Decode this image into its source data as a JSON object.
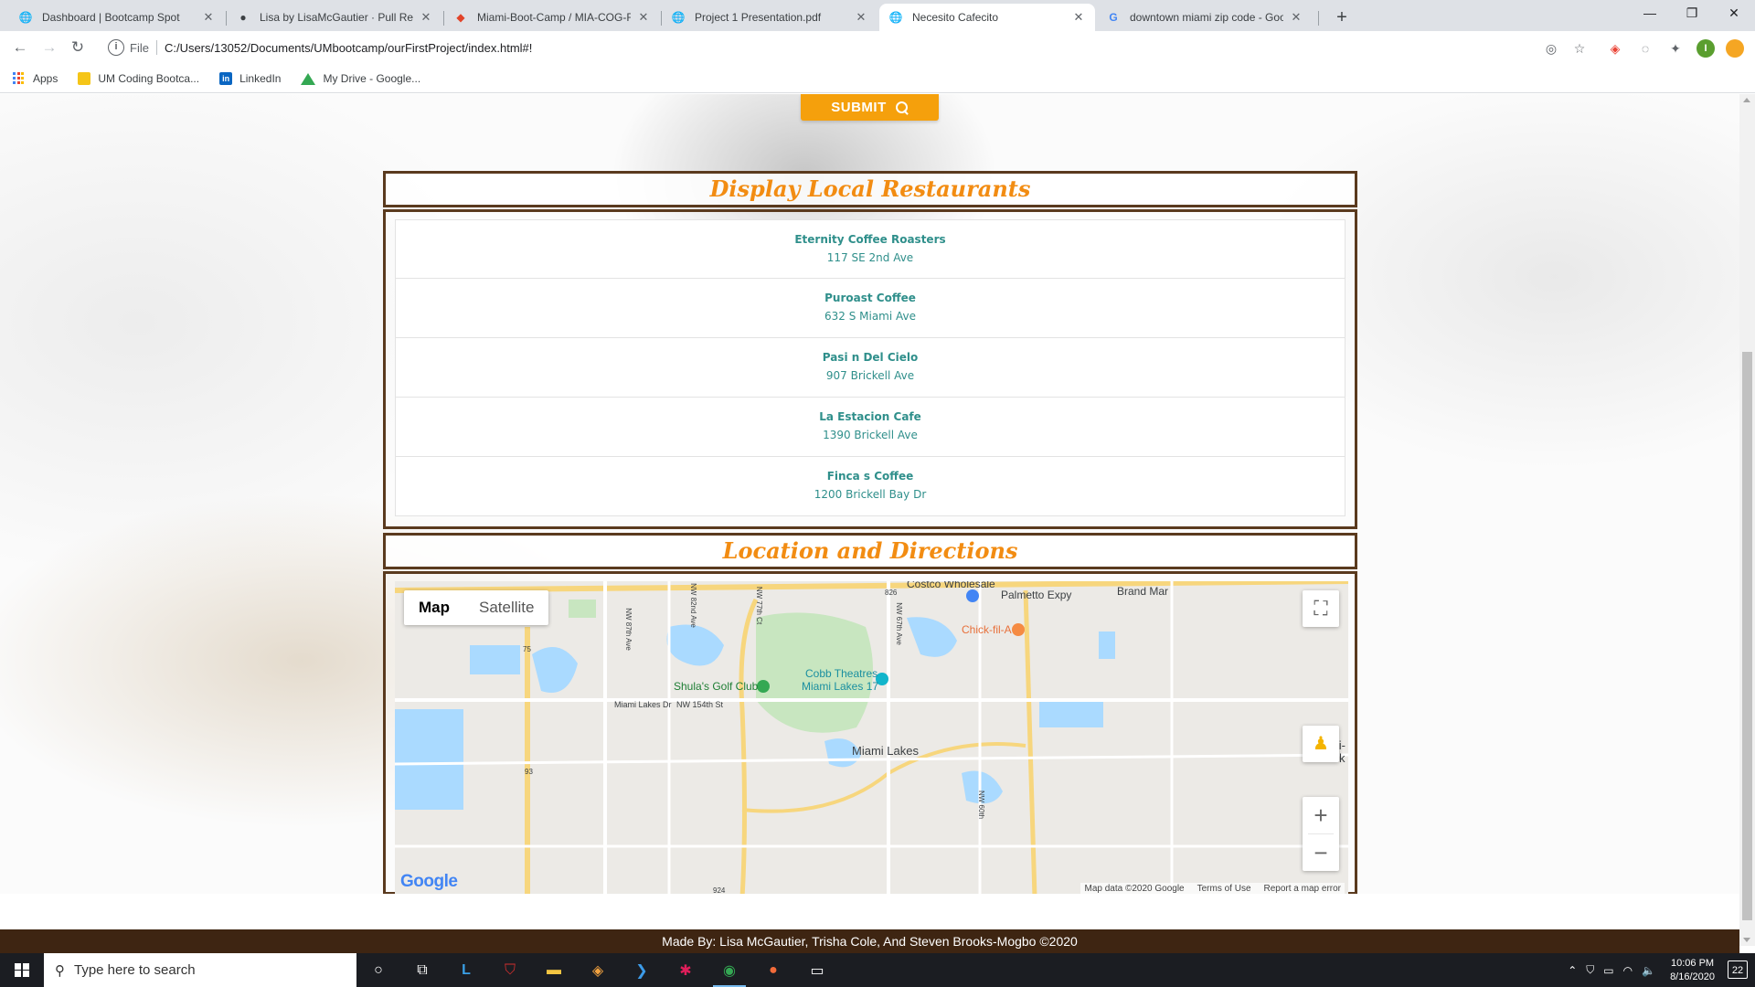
{
  "browser": {
    "tabs": [
      {
        "title": "Dashboard | Bootcamp Spot",
        "icon": "globe-icon"
      },
      {
        "title": "Lisa by LisaMcGautier · Pull Requ",
        "icon": "github-icon"
      },
      {
        "title": "Miami-Boot-Camp / MIA-COG-F",
        "icon": "gitlab-icon"
      },
      {
        "title": "Project 1 Presentation.pdf",
        "icon": "globe-icon"
      },
      {
        "title": "Necesito Cafecito",
        "icon": "globe-icon",
        "active": true
      },
      {
        "title": "downtown miami zip code - Goo",
        "icon": "google-icon"
      }
    ],
    "address": {
      "scheme": "File",
      "url": "C:/Users/13052/Documents/UMbootcamp/ourFirstProject/index.html#!"
    },
    "profile_initial": "I",
    "bookmarks": [
      {
        "label": "Apps",
        "icon": "apps-grid-icon"
      },
      {
        "label": "UM Coding Bootca...",
        "icon": "folder-icon"
      },
      {
        "label": "LinkedIn",
        "icon": "linkedin-icon"
      },
      {
        "label": "My Drive - Google...",
        "icon": "google-drive-icon"
      }
    ]
  },
  "page": {
    "submit_label": "SUBMIT",
    "restaurants_heading": "Display Local Restaurants",
    "restaurants": [
      {
        "name": "Eternity Coffee Roasters",
        "address": "117 SE 2nd Ave"
      },
      {
        "name": "Puroast Coffee",
        "address": "632 S Miami Ave"
      },
      {
        "name": "Pasi n Del Cielo",
        "address": "907 Brickell Ave"
      },
      {
        "name": "La Estacion Cafe",
        "address": "1390 Brickell Ave"
      },
      {
        "name": "Finca s Coffee",
        "address": "1200 Brickell Bay Dr"
      }
    ],
    "map_heading": "Location and Directions",
    "map": {
      "type_map": "Map",
      "type_satellite": "Satellite",
      "selected_type": "Map",
      "labels": {
        "costco": "Costco Wholesale",
        "palmetto": "Palmetto Expy",
        "chickfila": "Chick-fil-A",
        "golf": "Shula's Golf Club",
        "cobb1": "Cobb Theatres",
        "cobb2": "Miami Lakes 17",
        "miami_lakes": "Miami Lakes",
        "lakes_dr": "Miami Lakes Dr",
        "nw154": "NW 154th St",
        "brand": "Brand Mar",
        "lock1": "Miami-",
        "lock2": "Lock",
        "nw87": "NW 87th Ave",
        "nw82": "NW 82nd Ave",
        "nw77": "NW 77th Ct",
        "nw67": "NW 67th Ave",
        "nw60": "NW 60th",
        "r826": "826",
        "r75": "75",
        "r93": "93",
        "r924": "924"
      },
      "google": "Google",
      "attribution": {
        "data": "Map data ©2020 Google",
        "terms": "Terms of Use",
        "report": "Report a map error"
      }
    },
    "footer": "Made By: Lisa McGautier, Trisha Cole, And Steven Brooks-Mogbo ©2020"
  },
  "taskbar": {
    "search_placeholder": "Type here to search",
    "time": "10:06 PM",
    "date": "8/16/2020",
    "notifications": "22"
  }
}
